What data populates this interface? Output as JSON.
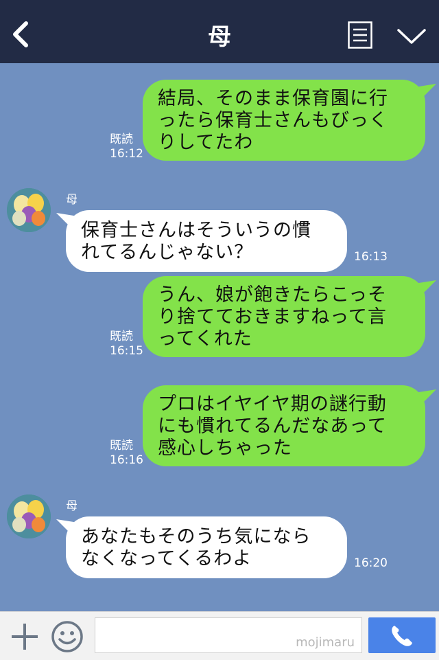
{
  "header": {
    "title": "母",
    "back_icon": "chevron-left-icon",
    "menu_icon": "menu-icon",
    "collapse_icon": "chevron-down-icon"
  },
  "messages": [
    {
      "dir": "out",
      "text": "結局、そのまま保育園に行\nったら保育士さんもびっく\nりしてたわ",
      "read": "既読",
      "time": "16:12"
    },
    {
      "dir": "in",
      "sender": "母",
      "text": "保育士さんはそういうの慣\nれてるんじゃない？",
      "time": "16:13"
    },
    {
      "dir": "out",
      "text": "うん、娘が飽きたらこっそ\nり捨てておきますねって言\nってくれた",
      "read": "既読",
      "time": "16:15"
    },
    {
      "dir": "out",
      "text": "プロはイヤイヤ期の謎行動\nにも慣れてるんだなあって\n感心しちゃった",
      "read": "既読",
      "time": "16:16"
    },
    {
      "dir": "in",
      "sender": "母",
      "text": "あなたもそのうち気になら\nなくなってくるわよ",
      "time": "16:20"
    }
  ],
  "footer": {
    "watermark": "mojimaru",
    "input_value": "",
    "plus_icon": "plus-icon",
    "sticker_icon": "smiley-icon",
    "call_icon": "phone-icon"
  },
  "colors": {
    "background": "#7090c0",
    "header": "#222b45",
    "outgoing": "#83e24a",
    "incoming": "#ffffff",
    "call_button": "#4a83e8"
  }
}
